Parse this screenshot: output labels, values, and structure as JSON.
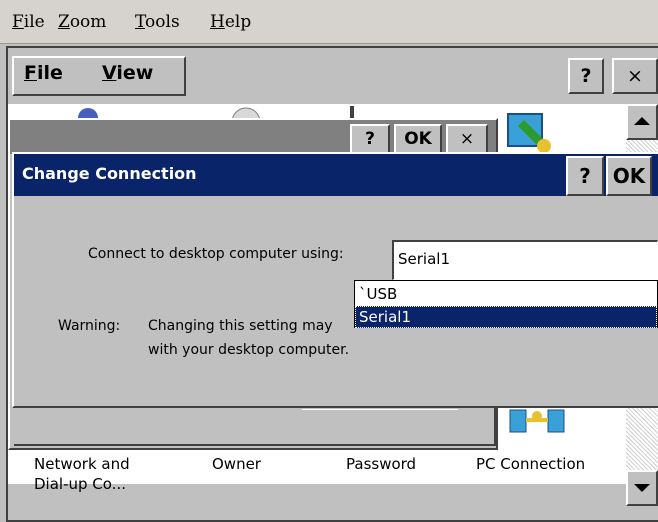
{
  "emulator_menu": {
    "file": "File",
    "zoom": "Zoom",
    "tools": "Tools",
    "help": "Help"
  },
  "ce_toolbar": {
    "file": "File",
    "view": "View",
    "help_btn": "?",
    "close_btn": "×"
  },
  "background_dialog": {
    "help_btn": "?",
    "ok_btn": "OK",
    "close_btn": "×"
  },
  "dialog": {
    "title": "Change Connection",
    "help_btn": "?",
    "ok_btn": "OK",
    "connect_label": "Connect to desktop computer using:",
    "combo_value": "Serial1",
    "options": [
      "`USB",
      "Serial1"
    ],
    "selected_option": "Serial1",
    "warning_label": "Warning:",
    "warning_line1": "Changing this setting may",
    "warning_line2": "with your desktop computer."
  },
  "icons": [
    {
      "label_line1": "Network and",
      "label_line2": "Dial-up Co..."
    },
    {
      "label_line1": "Owner",
      "label_line2": ""
    },
    {
      "label_line1": "Password",
      "label_line2": ""
    },
    {
      "label_line1": "PC Connection",
      "label_line2": ""
    }
  ],
  "colors": {
    "titlebar_active": "#0a246a",
    "titlebar_inactive": "#808080",
    "face": "#c0c0c0"
  }
}
